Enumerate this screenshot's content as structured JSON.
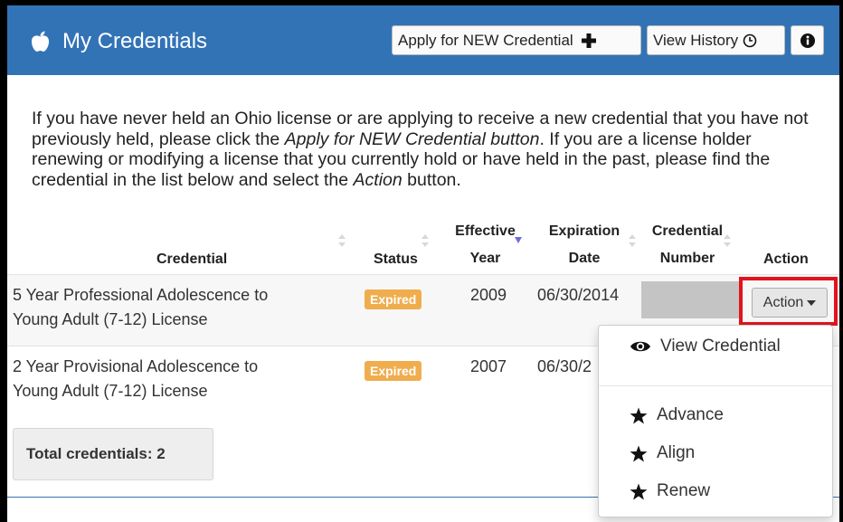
{
  "header": {
    "title": "My Credentials",
    "apply_label": "Apply for NEW Credential",
    "history_label": "View History",
    "info_label": "i"
  },
  "intro": {
    "t1": "If you have never held an Ohio license or are applying to receive a new credential that you have not previously held, please click the ",
    "em1": "Apply for NEW Credential button",
    "t2": ". If you are a license holder renewing or modifying a license that you currently hold or have held in the past, please find the credential in the list below and select the ",
    "em2": "Action",
    "t3": " button."
  },
  "table": {
    "headers": {
      "credential": "Credential",
      "status": "Status",
      "effective_1": "Effective",
      "effective_2": "Year",
      "expiration_1": "Expiration",
      "expiration_2": "Date",
      "number_1": "Credential",
      "number_2": "Number",
      "action": "Action"
    },
    "rows": [
      {
        "credential_1": "5 Year Professional Adolescence to",
        "credential_2": "Young Adult (7-12) License",
        "status": "Expired",
        "effective_year": "2009",
        "expiration_date": "06/30/2014"
      },
      {
        "credential_1": "2 Year Provisional Adolescence to",
        "credential_2": "Young Adult (7-12) License",
        "status": "Expired",
        "effective_year": "2007",
        "expiration_date": "06/30/2"
      }
    ],
    "action_button": "Action"
  },
  "total": "Total credentials: 2",
  "menu": {
    "view": "View Credential",
    "advance": "Advance",
    "align": "Align",
    "renew": "Renew"
  },
  "colors": {
    "header_bg": "#3273b6",
    "badge": "#f0ad4e",
    "highlight": "#e0141e"
  }
}
